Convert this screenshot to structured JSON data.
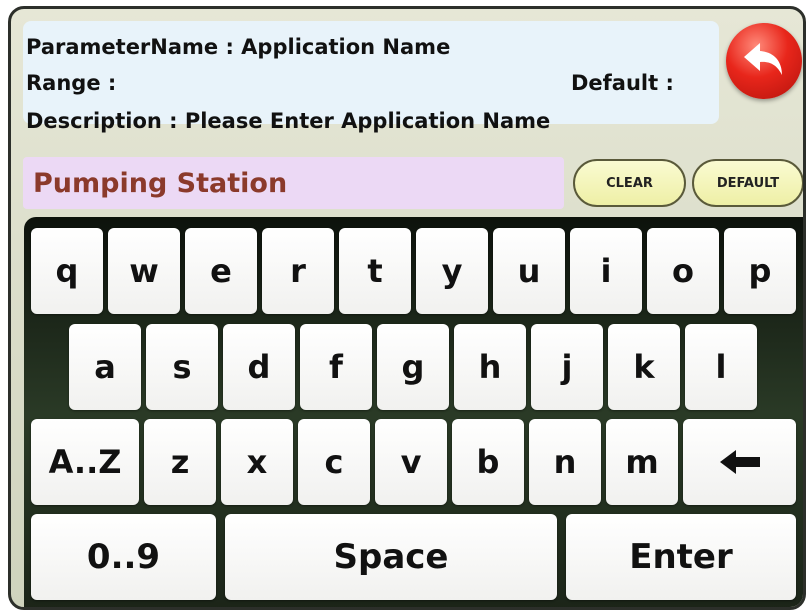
{
  "info": {
    "parameter_name": "ParameterName : Application Name",
    "range": "Range :",
    "default": "Default :",
    "description": "Description : Please Enter Application Name"
  },
  "input": {
    "value": "Pumping Station"
  },
  "buttons": {
    "clear": "CLEAR",
    "default": "DEFAULT"
  },
  "icons": {
    "back": "back-arrow-icon",
    "backspace": "backspace-arrow-icon"
  },
  "colors": {
    "back_button": "#e8261b",
    "input_bg": "#ecd9f5",
    "input_text": "#8b3a2b",
    "pill_bg": "#f3f4b8"
  },
  "keyboard": {
    "row1": [
      "q",
      "w",
      "e",
      "r",
      "t",
      "y",
      "u",
      "i",
      "o",
      "p"
    ],
    "row2": [
      "a",
      "s",
      "d",
      "f",
      "g",
      "h",
      "j",
      "k",
      "l"
    ],
    "row3": [
      "A..Z",
      "z",
      "x",
      "c",
      "v",
      "b",
      "n",
      "m"
    ],
    "row4": [
      "0..9",
      "Space",
      "Enter"
    ]
  }
}
